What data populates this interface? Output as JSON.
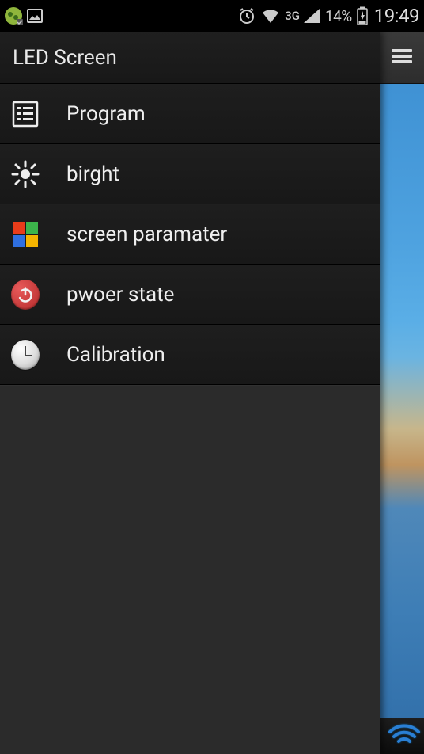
{
  "statusbar": {
    "network_label": "3G",
    "battery_pct": "14%",
    "time": "19:49"
  },
  "drawer": {
    "title": "LED Screen",
    "items": [
      {
        "label": "Program"
      },
      {
        "label": "birght"
      },
      {
        "label": "screen paramater"
      },
      {
        "label": "pwoer state"
      },
      {
        "label": "Calibration"
      }
    ]
  }
}
